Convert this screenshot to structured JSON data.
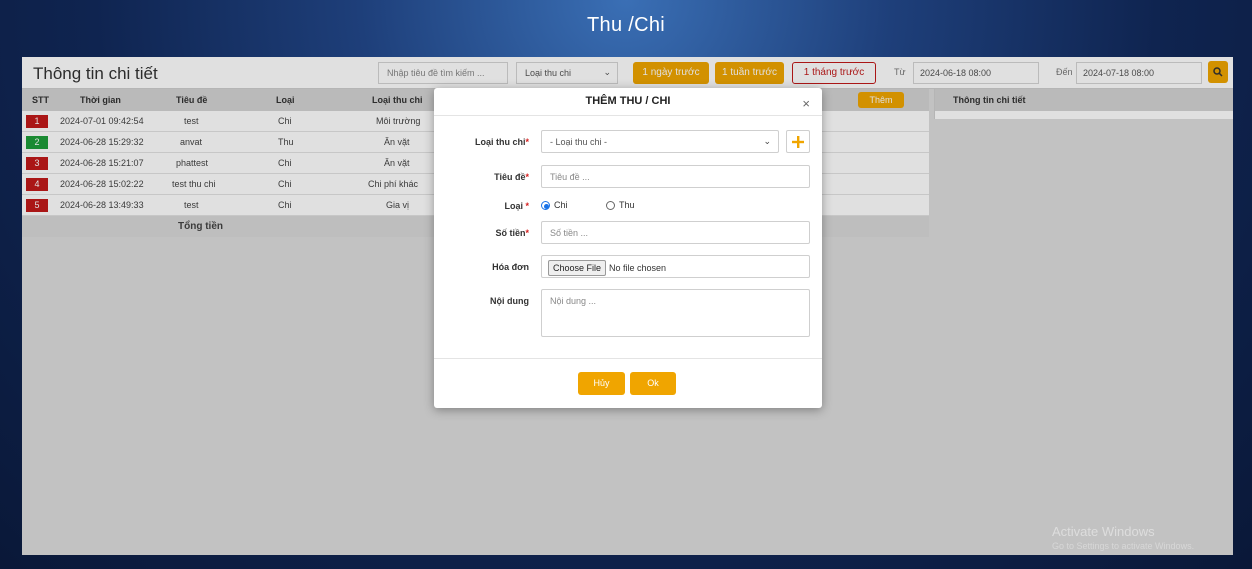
{
  "app": {
    "title": "Thu /Chi"
  },
  "toolbar": {
    "panel_title": "Thông tin chi tiết",
    "search_placeholder": "Nhập tiêu đề tìm kiếm ...",
    "type_filter": "Loại thu chi",
    "range_buttons": [
      "1 ngày trước",
      "1 tuần trước",
      "1 tháng trước"
    ],
    "active_range": "1 tháng trước",
    "from_label": "Từ",
    "from_value": "2024-06-18 08:00",
    "to_label": "Đến",
    "to_value": "2024-07-18 08:00",
    "search_icon": "search-icon"
  },
  "table": {
    "headers": [
      "STT",
      "Thời gian",
      "Tiêu đề",
      "Loại",
      "Loại thu chi"
    ],
    "add_label": "Thêm",
    "rows": [
      {
        "stt": "1",
        "time": "2024-07-01 09:42:54",
        "title": "test",
        "type": "Chi",
        "category": "Môi trường",
        "color": "#c21a1a"
      },
      {
        "stt": "2",
        "time": "2024-06-28 15:29:32",
        "title": "anvat",
        "type": "Thu",
        "category": "Ăn vặt",
        "color": "#1e9e3a"
      },
      {
        "stt": "3",
        "time": "2024-06-28 15:21:07",
        "title": "phattest",
        "type": "Chi",
        "category": "Ăn vặt",
        "color": "#c21a1a"
      },
      {
        "stt": "4",
        "time": "2024-06-28 15:02:22",
        "title": "test thu chi",
        "type": "Chi",
        "category": "Chi phí khác",
        "color": "#c21a1a"
      },
      {
        "stt": "5",
        "time": "2024-06-28 13:49:33",
        "title": "test",
        "type": "Chi",
        "category": "Gia vị",
        "color": "#c21a1a"
      }
    ],
    "total_label": "Tổng tiền"
  },
  "detail": {
    "header": "Thông tin chi tiết"
  },
  "modal": {
    "title": "THÊM THU / CHI",
    "close": "×",
    "category_label": "Loại thu chi",
    "category_value": "- Loại thu chi -",
    "title_label": "Tiêu đề",
    "title_placeholder": "Tiêu đề ...",
    "type_label": "Loại",
    "type_options": [
      "Chi",
      "Thu"
    ],
    "type_selected": "Chi",
    "amount_label": "Số tiền",
    "amount_placeholder": "Số tiền ...",
    "invoice_label": "Hóa đơn",
    "file_button": "Choose File",
    "file_status": "No file chosen",
    "content_label": "Nội dung",
    "content_placeholder": "Nội dung ...",
    "cancel_label": "Hủy",
    "ok_label": "Ok"
  },
  "watermark": {
    "line1": "Activate Windows",
    "line2": "Go to Settings to activate Windows."
  },
  "colors": {
    "accent": "#f0a500",
    "danger": "#c21a1a",
    "success": "#1e9e3a"
  }
}
